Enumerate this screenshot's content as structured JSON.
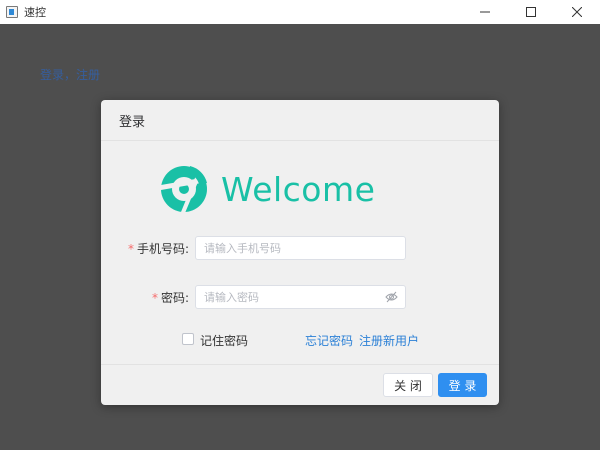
{
  "window": {
    "title": "速控",
    "minimize": "—",
    "maximize": "☐",
    "close": "✕"
  },
  "background": {
    "links": "登录，注册"
  },
  "dialog": {
    "title": "登录",
    "welcome": "Welcome",
    "phone": {
      "required": "*",
      "label": "手机号码:",
      "placeholder": "请输入手机号码",
      "value": ""
    },
    "password": {
      "required": "*",
      "label": "密码:",
      "placeholder": "请输入密码",
      "value": "",
      "icon": "eye-off-icon"
    },
    "remember_label": "记住密码",
    "remember_checked": false,
    "forgot_link": "忘记密码",
    "register_link": "注册新用户",
    "close_button": "关 闭",
    "login_button": "登 录"
  },
  "colors": {
    "accent": "#2f8ff0",
    "logo": "#19c0a6",
    "link": "#2b80d6",
    "required": "#f56c6c",
    "overlay": "#4e4e4e"
  }
}
